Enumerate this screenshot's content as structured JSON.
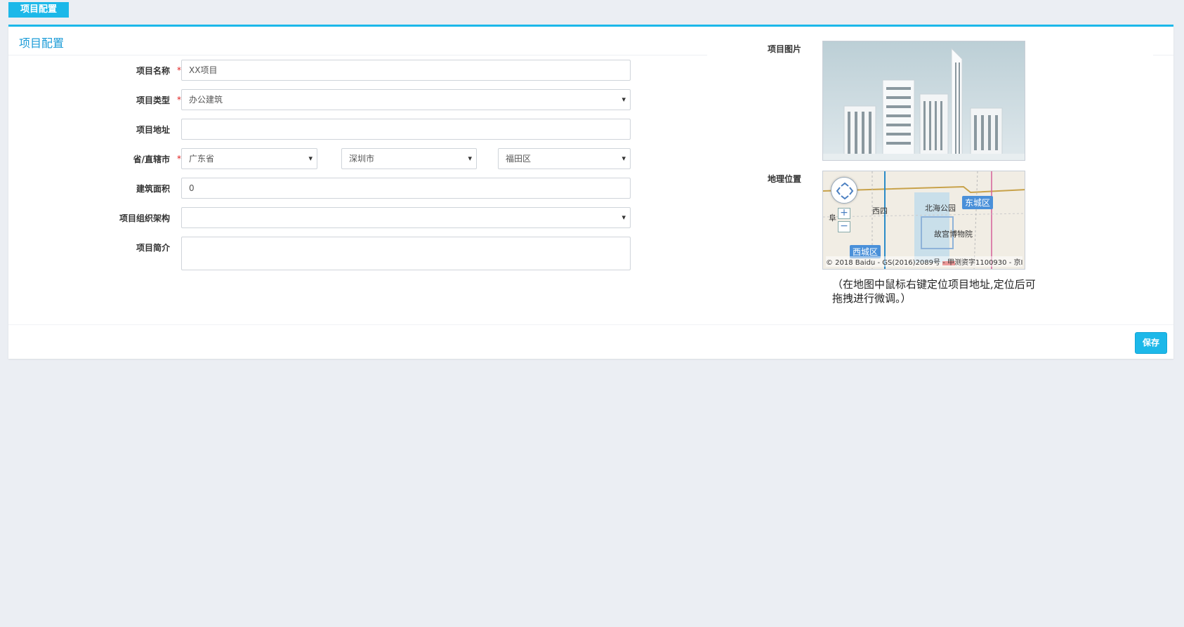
{
  "tab": {
    "label": "项目配置"
  },
  "panel": {
    "title": "项目配置"
  },
  "form": {
    "name": {
      "label": "项目名称",
      "value": "XX项目"
    },
    "type": {
      "label": "项目类型",
      "value": "办公建筑"
    },
    "address": {
      "label": "项目地址",
      "value": ""
    },
    "region": {
      "label": "省/直辖市",
      "province": "广东省",
      "city": "深圳市",
      "district": "福田区"
    },
    "area": {
      "label": "建筑面积",
      "value": "0"
    },
    "org": {
      "label": "项目组织架构",
      "value": ""
    },
    "intro": {
      "label": "项目简介",
      "value": ""
    },
    "required_mark": "*"
  },
  "right": {
    "photo_label": "项目图片",
    "map_label": "地理位置",
    "hint": "（在地图中鼠标右键定位项目地址,定位后可拖拽进行微调。）"
  },
  "map": {
    "copyright": "© 2018 Baidu - GS(2016)2089号 - 甲测资字1100930 - 京I",
    "places": [
      "北海公园",
      "西四",
      "故宫博物院",
      "阜"
    ],
    "districts": [
      "东城区",
      "西城区"
    ],
    "zoom_in": "+",
    "zoom_out": "−"
  },
  "actions": {
    "save": "保存"
  },
  "colors": {
    "accent": "#1cb8e9",
    "title": "#1a9bd7",
    "required": "#e02020"
  }
}
